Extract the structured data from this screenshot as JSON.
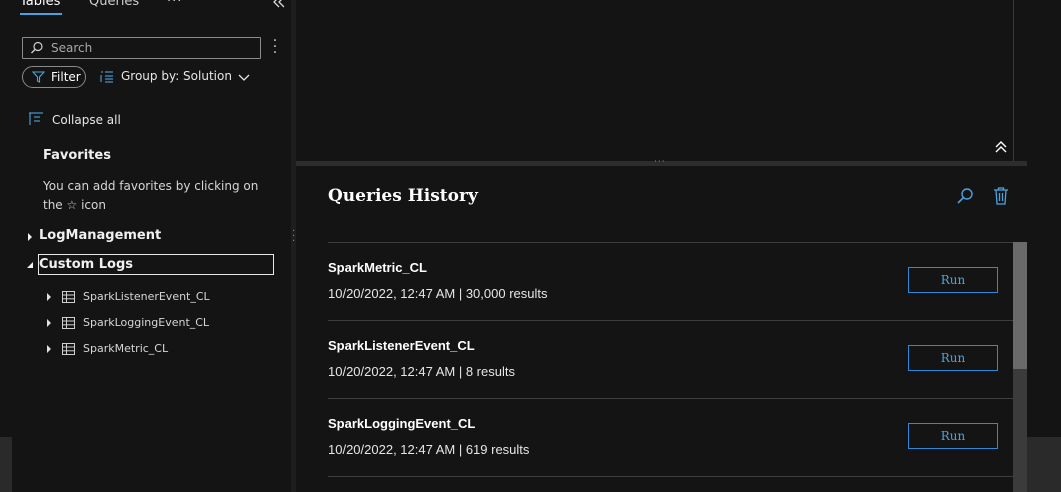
{
  "left_panel": {
    "tabs": [
      {
        "label": "Tables",
        "active": true
      },
      {
        "label": "Queries",
        "active": false
      }
    ],
    "more_tabs": "···",
    "search": {
      "placeholder": "Search",
      "value": ""
    },
    "filter_label": "Filter",
    "group_by_label": "Group by: Solution",
    "collapse_all_label": "Collapse all",
    "favorites": {
      "title": "Favorites",
      "hint": "You can add favorites by clicking on the ☆ icon"
    },
    "tree": {
      "groups": [
        {
          "label": "LogManagement",
          "expanded": false
        },
        {
          "label": "Custom Logs",
          "expanded": true
        }
      ],
      "custom_logs_tables": [
        "SparkListenerEvent_CL",
        "SparkLoggingEvent_CL",
        "SparkMetric_CL"
      ]
    }
  },
  "history": {
    "title": "Queries History",
    "rows": [
      {
        "name": "SparkMetric_CL",
        "meta": "10/20/2022, 12:47 AM | 30,000 results",
        "run_label": "Run"
      },
      {
        "name": "SparkListenerEvent_CL",
        "meta": "10/20/2022, 12:47 AM | 8 results",
        "run_label": "Run"
      },
      {
        "name": "SparkLoggingEvent_CL",
        "meta": "10/20/2022, 12:47 AM | 619 results",
        "run_label": "Run"
      }
    ]
  },
  "colors": {
    "background": "#141414",
    "accent": "#4aa3e0",
    "text": "#e6e6e6",
    "border": "#8a8a8a"
  },
  "icons": [
    "search-icon",
    "kebab-icon",
    "filter-icon",
    "group-by-icon",
    "chevron-down-icon",
    "collapse-all-icon",
    "caret-right-icon",
    "caret-down-icon",
    "table-icon",
    "double-chevron-left-icon",
    "double-chevron-up-icon",
    "trash-icon"
  ]
}
